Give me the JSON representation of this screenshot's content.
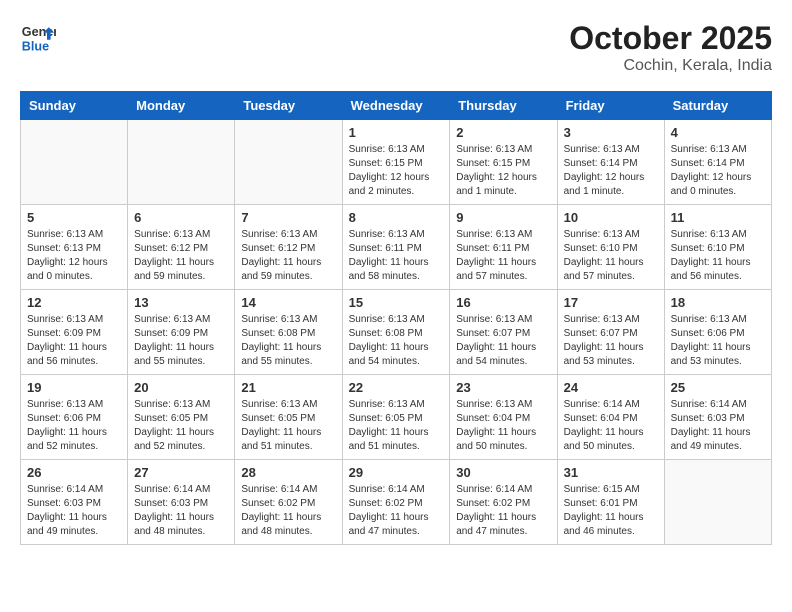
{
  "header": {
    "logo_line1": "General",
    "logo_line2": "Blue",
    "month_title": "October 2025",
    "location": "Cochin, Kerala, India"
  },
  "weekdays": [
    "Sunday",
    "Monday",
    "Tuesday",
    "Wednesday",
    "Thursday",
    "Friday",
    "Saturday"
  ],
  "weeks": [
    [
      {
        "day": "",
        "info": ""
      },
      {
        "day": "",
        "info": ""
      },
      {
        "day": "",
        "info": ""
      },
      {
        "day": "1",
        "info": "Sunrise: 6:13 AM\nSunset: 6:15 PM\nDaylight: 12 hours\nand 2 minutes."
      },
      {
        "day": "2",
        "info": "Sunrise: 6:13 AM\nSunset: 6:15 PM\nDaylight: 12 hours\nand 1 minute."
      },
      {
        "day": "3",
        "info": "Sunrise: 6:13 AM\nSunset: 6:14 PM\nDaylight: 12 hours\nand 1 minute."
      },
      {
        "day": "4",
        "info": "Sunrise: 6:13 AM\nSunset: 6:14 PM\nDaylight: 12 hours\nand 0 minutes."
      }
    ],
    [
      {
        "day": "5",
        "info": "Sunrise: 6:13 AM\nSunset: 6:13 PM\nDaylight: 12 hours\nand 0 minutes."
      },
      {
        "day": "6",
        "info": "Sunrise: 6:13 AM\nSunset: 6:12 PM\nDaylight: 11 hours\nand 59 minutes."
      },
      {
        "day": "7",
        "info": "Sunrise: 6:13 AM\nSunset: 6:12 PM\nDaylight: 11 hours\nand 59 minutes."
      },
      {
        "day": "8",
        "info": "Sunrise: 6:13 AM\nSunset: 6:11 PM\nDaylight: 11 hours\nand 58 minutes."
      },
      {
        "day": "9",
        "info": "Sunrise: 6:13 AM\nSunset: 6:11 PM\nDaylight: 11 hours\nand 57 minutes."
      },
      {
        "day": "10",
        "info": "Sunrise: 6:13 AM\nSunset: 6:10 PM\nDaylight: 11 hours\nand 57 minutes."
      },
      {
        "day": "11",
        "info": "Sunrise: 6:13 AM\nSunset: 6:10 PM\nDaylight: 11 hours\nand 56 minutes."
      }
    ],
    [
      {
        "day": "12",
        "info": "Sunrise: 6:13 AM\nSunset: 6:09 PM\nDaylight: 11 hours\nand 56 minutes."
      },
      {
        "day": "13",
        "info": "Sunrise: 6:13 AM\nSunset: 6:09 PM\nDaylight: 11 hours\nand 55 minutes."
      },
      {
        "day": "14",
        "info": "Sunrise: 6:13 AM\nSunset: 6:08 PM\nDaylight: 11 hours\nand 55 minutes."
      },
      {
        "day": "15",
        "info": "Sunrise: 6:13 AM\nSunset: 6:08 PM\nDaylight: 11 hours\nand 54 minutes."
      },
      {
        "day": "16",
        "info": "Sunrise: 6:13 AM\nSunset: 6:07 PM\nDaylight: 11 hours\nand 54 minutes."
      },
      {
        "day": "17",
        "info": "Sunrise: 6:13 AM\nSunset: 6:07 PM\nDaylight: 11 hours\nand 53 minutes."
      },
      {
        "day": "18",
        "info": "Sunrise: 6:13 AM\nSunset: 6:06 PM\nDaylight: 11 hours\nand 53 minutes."
      }
    ],
    [
      {
        "day": "19",
        "info": "Sunrise: 6:13 AM\nSunset: 6:06 PM\nDaylight: 11 hours\nand 52 minutes."
      },
      {
        "day": "20",
        "info": "Sunrise: 6:13 AM\nSunset: 6:05 PM\nDaylight: 11 hours\nand 52 minutes."
      },
      {
        "day": "21",
        "info": "Sunrise: 6:13 AM\nSunset: 6:05 PM\nDaylight: 11 hours\nand 51 minutes."
      },
      {
        "day": "22",
        "info": "Sunrise: 6:13 AM\nSunset: 6:05 PM\nDaylight: 11 hours\nand 51 minutes."
      },
      {
        "day": "23",
        "info": "Sunrise: 6:13 AM\nSunset: 6:04 PM\nDaylight: 11 hours\nand 50 minutes."
      },
      {
        "day": "24",
        "info": "Sunrise: 6:14 AM\nSunset: 6:04 PM\nDaylight: 11 hours\nand 50 minutes."
      },
      {
        "day": "25",
        "info": "Sunrise: 6:14 AM\nSunset: 6:03 PM\nDaylight: 11 hours\nand 49 minutes."
      }
    ],
    [
      {
        "day": "26",
        "info": "Sunrise: 6:14 AM\nSunset: 6:03 PM\nDaylight: 11 hours\nand 49 minutes."
      },
      {
        "day": "27",
        "info": "Sunrise: 6:14 AM\nSunset: 6:03 PM\nDaylight: 11 hours\nand 48 minutes."
      },
      {
        "day": "28",
        "info": "Sunrise: 6:14 AM\nSunset: 6:02 PM\nDaylight: 11 hours\nand 48 minutes."
      },
      {
        "day": "29",
        "info": "Sunrise: 6:14 AM\nSunset: 6:02 PM\nDaylight: 11 hours\nand 47 minutes."
      },
      {
        "day": "30",
        "info": "Sunrise: 6:14 AM\nSunset: 6:02 PM\nDaylight: 11 hours\nand 47 minutes."
      },
      {
        "day": "31",
        "info": "Sunrise: 6:15 AM\nSunset: 6:01 PM\nDaylight: 11 hours\nand 46 minutes."
      },
      {
        "day": "",
        "info": ""
      }
    ]
  ]
}
